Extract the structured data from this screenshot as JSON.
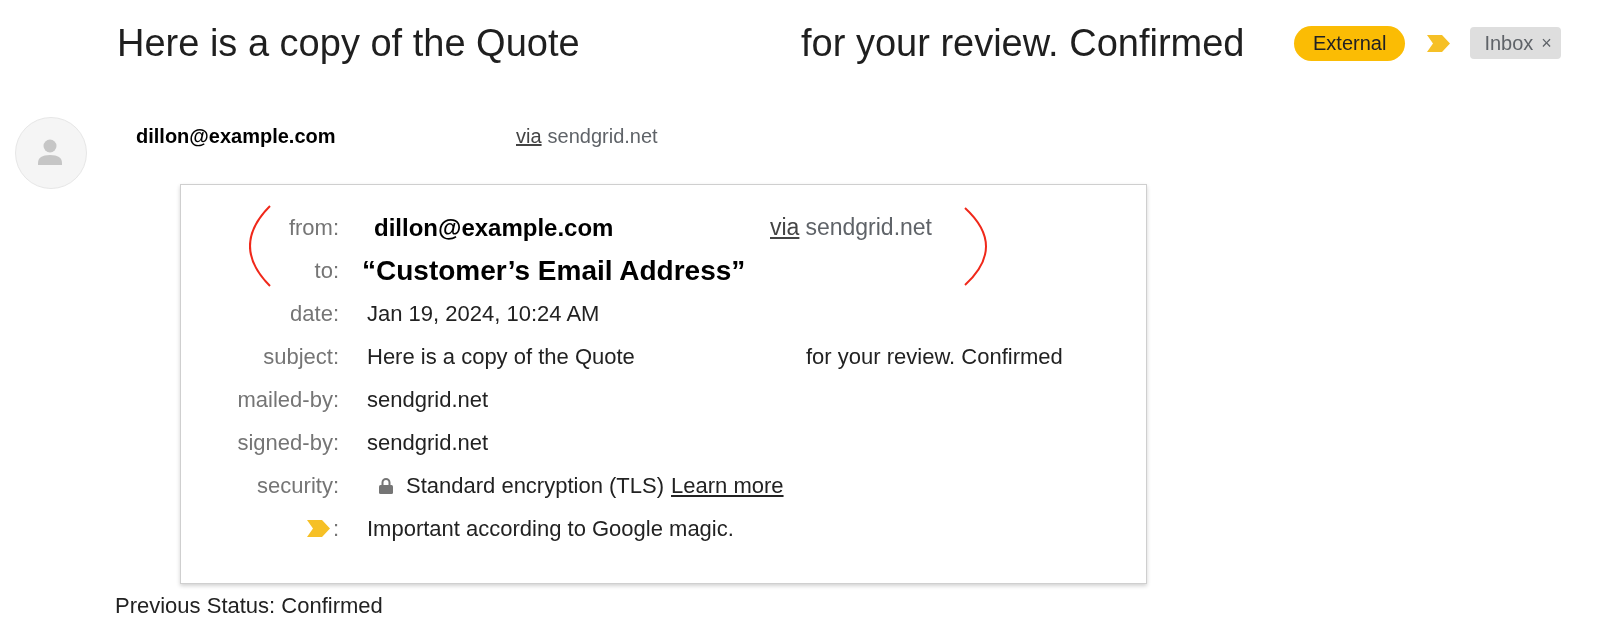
{
  "thread": {
    "subject_parts": [
      "Here is a copy of the Quote",
      "for your review. Confirmed"
    ],
    "labels": [
      {
        "kind": "badge",
        "text": "External"
      },
      {
        "kind": "importance"
      },
      {
        "kind": "chip",
        "text": "Inbox",
        "remove": "×"
      }
    ]
  },
  "message": {
    "sender": "dillon@example.com",
    "via_label": "via",
    "via_domain": "sendgrid.net"
  },
  "details": {
    "rows": [
      {
        "kind": "sender",
        "label": "from:",
        "value": "dillon@example.com",
        "via_label": "via",
        "via_domain": "sendgrid.net"
      },
      {
        "kind": "recipient",
        "label": "to:",
        "value": "“Customer’s Email Address”"
      },
      {
        "kind": "text",
        "label": "date:",
        "value": "Jan 19, 2024, 10:24 AM"
      },
      {
        "kind": "split",
        "label": "subject:",
        "value_parts": [
          "Here is a copy of the Quote",
          "for your review. Confirmed"
        ]
      },
      {
        "kind": "text",
        "label": "mailed-by:",
        "value": "sendgrid.net"
      },
      {
        "kind": "text",
        "label": "signed-by:",
        "value": "sendgrid.net"
      },
      {
        "kind": "security",
        "label": "security:",
        "value": "Standard encryption (TLS)",
        "link": "Learn more"
      },
      {
        "kind": "importance",
        "label": ":",
        "value": "Important according to Google magic."
      }
    ]
  },
  "footer": {
    "text": "Previous Status: Confirmed"
  }
}
